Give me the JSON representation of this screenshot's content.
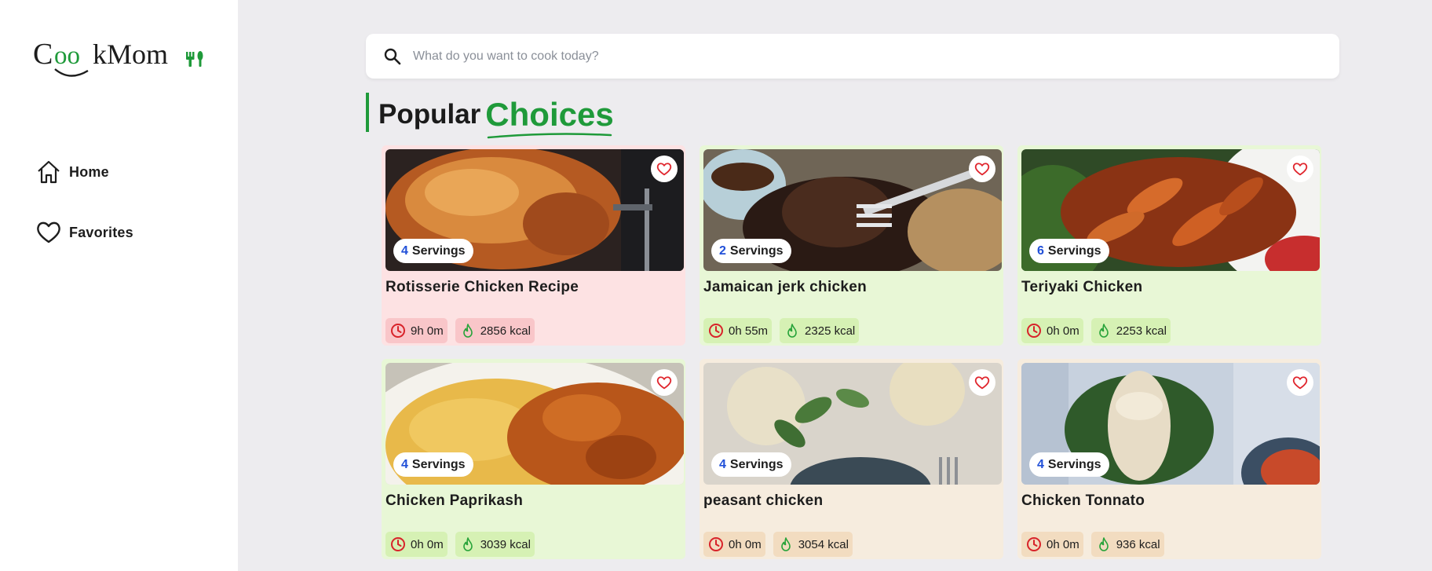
{
  "app": {
    "logo_text": "CookMom"
  },
  "sidebar": {
    "items": [
      {
        "label": "Home",
        "icon": "home-icon"
      },
      {
        "label": "Favorites",
        "icon": "heart-icon"
      }
    ]
  },
  "search": {
    "placeholder": "What do you want to cook today?",
    "value": ""
  },
  "section": {
    "title_part1": "Popular",
    "title_part2": "Choices"
  },
  "colors": {
    "accent": "#1f9a3a",
    "servings_number": "#2150d8",
    "card_pink": "#fde2e3",
    "card_green": "#e8f7d6",
    "card_tan": "#f6ecde",
    "chip_pink": "#f9c6c9",
    "chip_green": "#d6f1b4",
    "chip_tan": "#f2dcc0"
  },
  "recipes": [
    {
      "title": "Rotisserie Chicken Recipe",
      "servings_count": "4",
      "servings_label": "Servings",
      "time": "9h 0m",
      "calories": "2856 kcal",
      "theme": "pink"
    },
    {
      "title": "Jamaican jerk chicken",
      "servings_count": "2",
      "servings_label": "Servings",
      "time": "0h 55m",
      "calories": "2325 kcal",
      "theme": "green"
    },
    {
      "title": "Teriyaki Chicken",
      "servings_count": "6",
      "servings_label": "Servings",
      "time": "0h 0m",
      "calories": "2253 kcal",
      "theme": "green"
    },
    {
      "title": "Chicken Paprikash",
      "servings_count": "4",
      "servings_label": "Servings",
      "time": "0h 0m",
      "calories": "3039 kcal",
      "theme": "green"
    },
    {
      "title": "peasant chicken",
      "servings_count": "4",
      "servings_label": "Servings",
      "time": "0h 0m",
      "calories": "3054 kcal",
      "theme": "tan"
    },
    {
      "title": "Chicken Tonnato",
      "servings_count": "4",
      "servings_label": "Servings",
      "time": "0h 0m",
      "calories": "936 kcal",
      "theme": "tan"
    }
  ]
}
